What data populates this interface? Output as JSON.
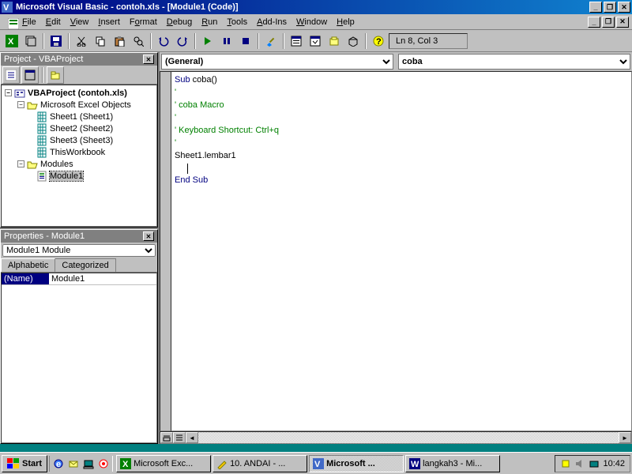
{
  "title": "Microsoft Visual Basic - contoh.xls - [Module1 (Code)]",
  "menu": [
    "File",
    "Edit",
    "View",
    "Insert",
    "Format",
    "Debug",
    "Run",
    "Tools",
    "Add-Ins",
    "Window",
    "Help"
  ],
  "cursor_pos": "Ln 8, Col 3",
  "project_panel": {
    "title": "Project - VBAProject",
    "root": "VBAProject (contoh.xls)",
    "folder1": "Microsoft Excel Objects",
    "sheets": [
      "Sheet1 (Sheet1)",
      "Sheet2 (Sheet2)",
      "Sheet3 (Sheet3)",
      "ThisWorkbook"
    ],
    "folder2": "Modules",
    "module": "Module1"
  },
  "properties_panel": {
    "title": "Properties - Module1",
    "selected": "Module1 Module",
    "tabs": [
      "Alphabetic",
      "Categorized"
    ],
    "name_label": "(Name)",
    "name_value": "Module1"
  },
  "code": {
    "object_dd": "(General)",
    "proc_dd": "coba",
    "lines": [
      {
        "t": "Sub ",
        "c": "kw"
      },
      {
        "t": "coba()",
        "c": ""
      },
      {
        "br": true
      },
      {
        "t": "'",
        "c": "cm"
      },
      {
        "br": true
      },
      {
        "t": "' coba Macro",
        "c": "cm"
      },
      {
        "br": true
      },
      {
        "t": "'",
        "c": "cm"
      },
      {
        "br": true
      },
      {
        "t": "' Keyboard Shortcut: Ctrl+q",
        "c": "cm"
      },
      {
        "br": true
      },
      {
        "t": "'",
        "c": "cm"
      },
      {
        "br": true
      },
      {
        "t": "Sheet1.lembar1",
        "c": ""
      },
      {
        "br": true
      },
      {
        "caret": true
      },
      {
        "br": true
      },
      {
        "t": "End Sub",
        "c": "kw"
      }
    ]
  },
  "taskbar": {
    "start": "Start",
    "tasks": [
      {
        "label": "Microsoft Exc...",
        "icon": "excel",
        "active": false
      },
      {
        "label": "10. ANDAI - ...",
        "icon": "pencil",
        "active": false
      },
      {
        "label": "Microsoft ...",
        "icon": "vb",
        "active": true
      },
      {
        "label": "langkah3 - Mi...",
        "icon": "word",
        "active": false
      }
    ],
    "clock": "10:42"
  }
}
